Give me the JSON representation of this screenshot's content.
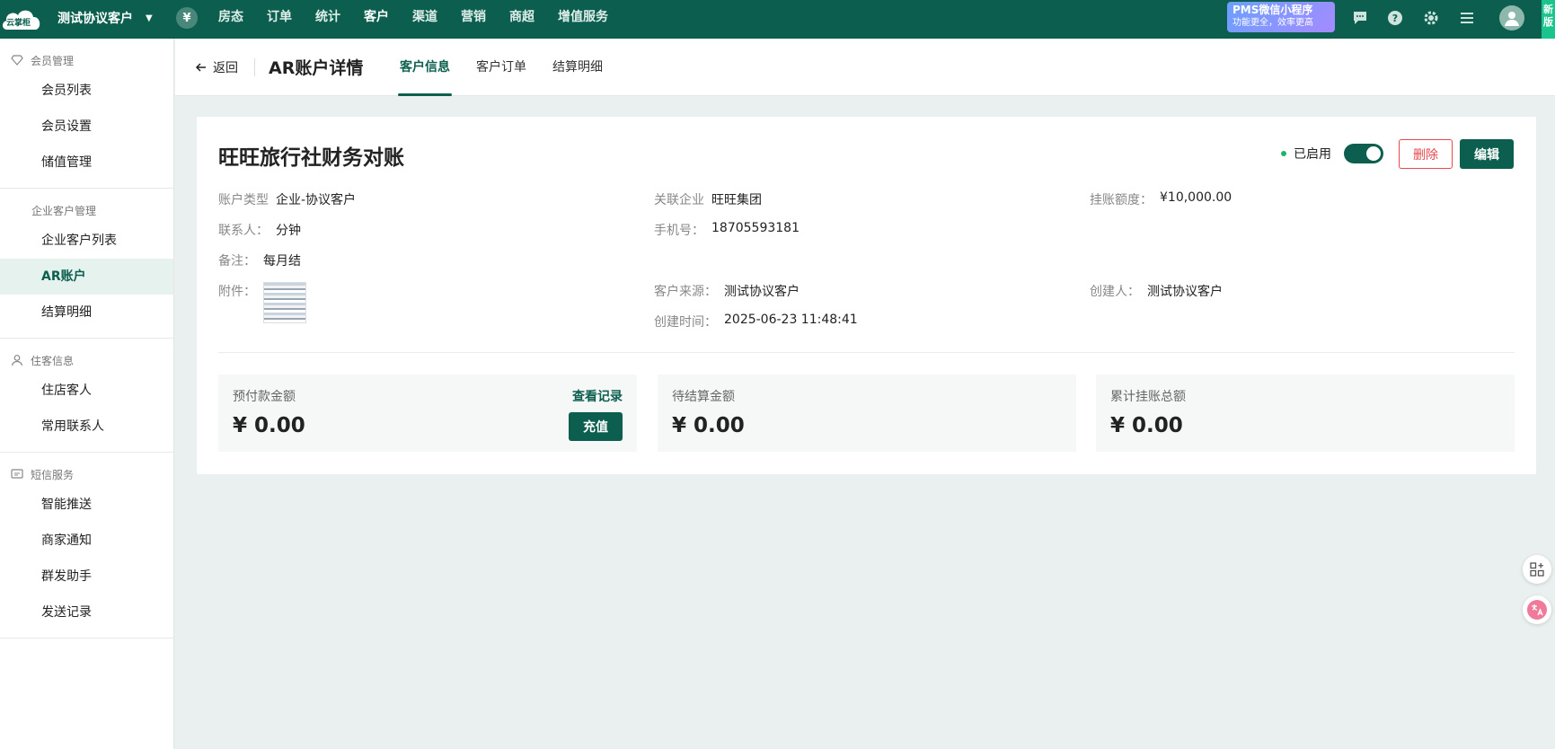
{
  "topbar": {
    "logo_text": "云掌柜",
    "hotel_name": "测试协议客户",
    "currency_symbol": "¥",
    "nav": [
      "房态",
      "订单",
      "统计",
      "客户",
      "渠道",
      "营销",
      "商超",
      "增值服务"
    ],
    "active_nav": "客户",
    "promo_line1": "PMS微信小程序",
    "promo_line2": "功能更全，效率更高",
    "new_badge": "新版"
  },
  "sidebar": {
    "groups": [
      {
        "title": "会员管理",
        "icon": "diamond-icon",
        "items": [
          "会员列表",
          "会员设置",
          "储值管理"
        ]
      },
      {
        "title": "企业客户管理",
        "icon": "",
        "items": [
          "企业客户列表",
          "AR账户",
          "结算明细"
        ]
      },
      {
        "title": "住客信息",
        "icon": "user-icon",
        "items": [
          "住店客人",
          "常用联系人"
        ]
      },
      {
        "title": "短信服务",
        "icon": "message-icon",
        "items": [
          "智能推送",
          "商家通知",
          "群发助手",
          "发送记录"
        ]
      }
    ],
    "active_item": "AR账户"
  },
  "header": {
    "back_label": "返回",
    "title": "AR账户详情",
    "tabs": [
      "客户信息",
      "客户订单",
      "结算明细"
    ],
    "active_tab": "客户信息"
  },
  "account": {
    "name": "旺旺旅行社财务对账",
    "status_label": "已启用",
    "enabled": true,
    "delete_label": "删除",
    "edit_label": "编辑",
    "fields": {
      "account_type": {
        "label": "账户类型",
        "value": "企业-协议客户"
      },
      "company": {
        "label": "关联企业",
        "value": "旺旺集团"
      },
      "credit_limit": {
        "label": "挂账额度：",
        "value": "¥10,000.00"
      },
      "contact": {
        "label": "联系人：",
        "value": "分钟"
      },
      "phone": {
        "label": "手机号：",
        "value": "18705593181"
      },
      "remark": {
        "label": "备注：",
        "value": "每月结"
      },
      "attachment": {
        "label": "附件："
      },
      "source": {
        "label": "客户来源：",
        "value": "测试协议客户"
      },
      "creator": {
        "label": "创建人：",
        "value": "测试协议客户"
      },
      "created_at": {
        "label": "创建时间：",
        "value": "2025-06-23 11:48:41"
      }
    }
  },
  "stats": {
    "prepaid": {
      "label": "预付款金额",
      "value": "¥ 0.00",
      "link": "查看记录",
      "button": "充值"
    },
    "pending": {
      "label": "待结算金额",
      "value": "¥ 0.00"
    },
    "total": {
      "label": "累计挂账总额",
      "value": "¥ 0.00"
    }
  },
  "colors": {
    "brand": "#0c5f4f",
    "danger": "#e5484d",
    "success": "#21b36a"
  }
}
